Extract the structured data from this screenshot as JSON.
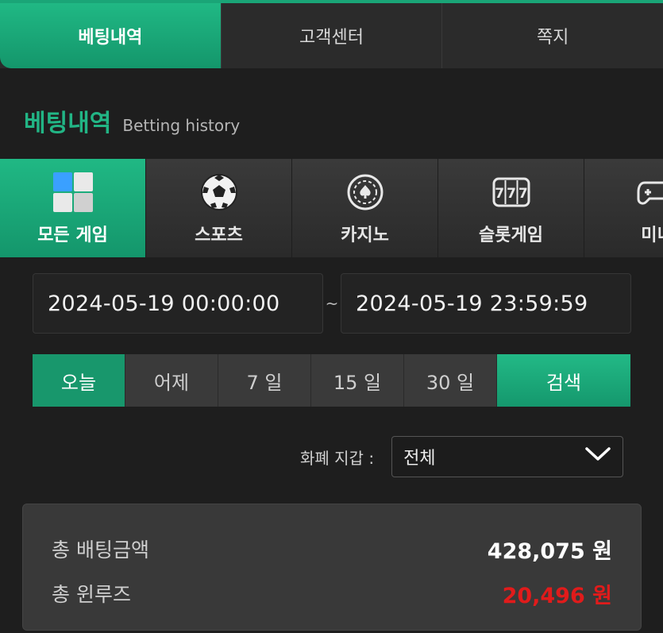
{
  "top_tabs": [
    {
      "label": "베팅내역"
    },
    {
      "label": "고객센터"
    },
    {
      "label": "쪽지"
    }
  ],
  "section": {
    "title_ko": "베팅내역",
    "title_en": "Betting history"
  },
  "game_tabs": [
    {
      "label": "모든 게임",
      "icon": "all-games-icon"
    },
    {
      "label": "스포츠",
      "icon": "soccer-ball-icon"
    },
    {
      "label": "카지노",
      "icon": "casino-chip-icon"
    },
    {
      "label": "슬롯게임",
      "icon": "slot-machine-icon"
    },
    {
      "label": "미니",
      "icon": "gamepad-icon"
    }
  ],
  "date_range": {
    "start": "2024-05-19 00:00:00",
    "separator": "~",
    "end": "2024-05-19 23:59:59"
  },
  "periods": [
    {
      "label": "오늘"
    },
    {
      "label": "어제"
    },
    {
      "label": "7 일"
    },
    {
      "label": "15 일"
    },
    {
      "label": "30 일"
    }
  ],
  "search_label": "검색",
  "currency": {
    "label": "화폐 지갑 :",
    "selected": "전체"
  },
  "summary": {
    "total_bet_label": "총 배팅금액",
    "total_bet_value": "428,075 원",
    "total_winloss_label": "총 윈루즈",
    "total_winloss_value": "20,496 원"
  },
  "colors": {
    "accent": "#1aa577",
    "negative": "#e11b1b"
  }
}
